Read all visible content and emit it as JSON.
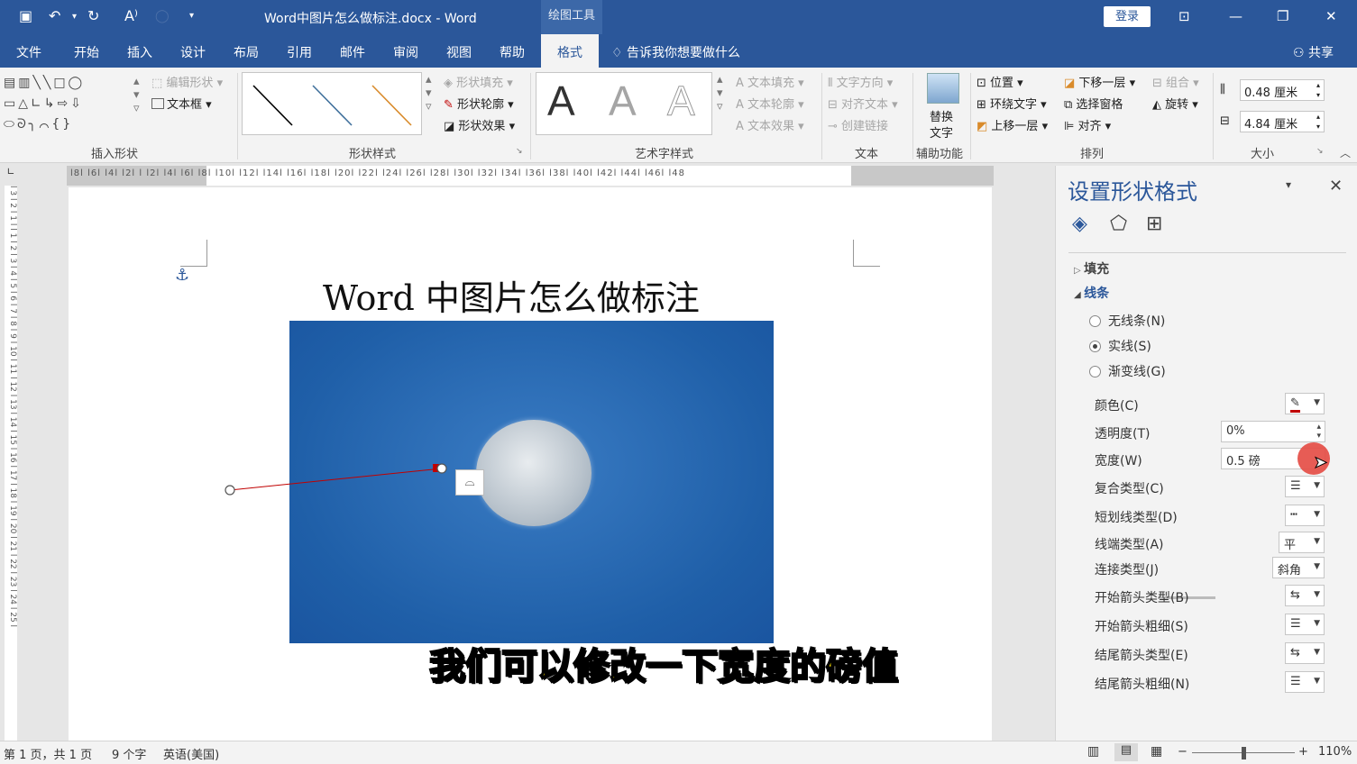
{
  "titlebar": {
    "title": "Word中图片怎么做标注.docx  -  Word",
    "context_tool": "绘图工具",
    "login": "登录"
  },
  "tabs": [
    "文件",
    "开始",
    "插入",
    "设计",
    "布局",
    "引用",
    "邮件",
    "审阅",
    "视图",
    "帮助",
    "格式"
  ],
  "tellme": "告诉我你想要做什么",
  "share": "共享",
  "ribbon": {
    "insert_shapes": {
      "label": "插入形状",
      "edit_shape": "编辑形状",
      "textbox": "文本框"
    },
    "shape_styles": {
      "label": "形状样式",
      "fill": "形状填充",
      "outline": "形状轮廓",
      "effects": "形状效果"
    },
    "wordart": {
      "label": "艺术字样式",
      "text_fill": "文本填充",
      "text_outline": "文本轮廓",
      "text_effects": "文本效果",
      "glyph": "A"
    },
    "text": {
      "label": "文本",
      "direction": "文字方向",
      "align": "对齐文本",
      "link": "创建链接"
    },
    "accessibility": {
      "label": "辅助功能",
      "alt_text_1": "替换",
      "alt_text_2": "文字"
    },
    "arrange": {
      "label": "排列",
      "position": "位置",
      "wrap": "环绕文字",
      "forward": "上移一层",
      "backward": "下移一层",
      "selection": "选择窗格",
      "align": "对齐",
      "group": "组合",
      "rotate": "旋转"
    },
    "size": {
      "label": "大小",
      "height": "0.48 厘米",
      "width": "4.84 厘米"
    }
  },
  "ruler": {
    "horizontal": "l8l  l6l  l4l  l2l   l  l2l  l4l  l6l  l8l  l10l  l12l  l14l  l16l  l18l  l20l  l22l  l24l  l26l  l28l  l30l  l32l  l34l  l36l  l38l  l40l  l42l  l44l  l46l  l48",
    "vertical": "l 3 l 2 l 1 l   l 1 l 2 l 3 l 4 l 5 l 6 l 7 l 8 l 9 l 10 l 11 l 12 l 13 l 14 l 15 l 16 l 17 l 18 l 19 l 20 l 21 l 22 l 23 l 24 l 25 l"
  },
  "document": {
    "heading": "Word 中图片怎么做标注",
    "caption": "我们可以修改一下宽度的磅值"
  },
  "pane": {
    "title": "设置形状格式",
    "fill_section": "填充",
    "line_section": "线条",
    "no_line": "无线条(N)",
    "solid_line": "实线(S)",
    "gradient_line": "渐变线(G)",
    "color": "颜色(C)",
    "transparency": "透明度(T)",
    "transparency_value": "0%",
    "width": "宽度(W)",
    "width_value": "0.5 磅",
    "compound": "复合类型(C)",
    "dash": "短划线类型(D)",
    "cap": "线端类型(A)",
    "cap_value": "平",
    "join": "连接类型(J)",
    "join_value": "斜角",
    "begin_arrow_type": "开始箭头类型(B)",
    "begin_arrow_size": "开始箭头粗细(S)",
    "end_arrow_type": "结尾箭头类型(E)",
    "end_arrow_size": "结尾箭头粗细(N)"
  },
  "status": {
    "page": "第 1 页，共 1 页",
    "words": "9 个字",
    "lang": "英语(美国)",
    "zoom": "110%"
  },
  "colors": {
    "accent": "#2b579a",
    "line": "#c00000",
    "caption": "#ffe500"
  }
}
